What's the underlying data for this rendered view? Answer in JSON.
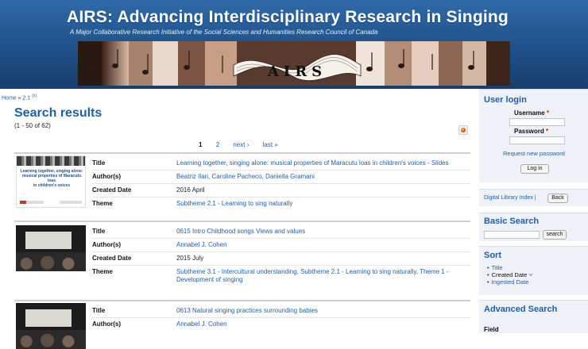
{
  "header": {
    "title": "AIRS: Advancing Interdisciplinary Research in Singing",
    "subtitle": "A Major Collaborative Research Initiative of the Social Sciences and Humanities Research Council of Canada",
    "logo_text": "AIRS"
  },
  "breadcrumb": {
    "home": "Home",
    "separator": "»",
    "current": "2.1",
    "current_sup": "(x)"
  },
  "results": {
    "title": "Search results",
    "count": "(1 - 50 of 62)",
    "pager": {
      "current": "1",
      "page2": "2",
      "next": "next ›",
      "last": "last »"
    },
    "field_labels": {
      "title": "Title",
      "authors": "Author(s)",
      "date": "Created Date",
      "theme": "Theme"
    },
    "items": [
      {
        "title": "Learning together, singing alone: musical properties of Maracutu loas in children's voices - Slides",
        "authors": "Beatriz Ilari, Caroline Pacheco, Daniella Gramani",
        "date": "2016 April",
        "theme": "Subtheme 2.1 - Learning to sing naturally",
        "thumb": {
          "line1": "Learning together, singing alone:",
          "line2": "musical properties of Maracutu loas",
          "line3": "in children's voices"
        }
      },
      {
        "title": "0615 Intro Childhood songs Views and values",
        "authors": "Annabel J. Cohen",
        "date": "2015 July",
        "theme": "Subtheme 3.1 - Intercultural understanding, Subtheme 2.1 - Learning to sing naturally, Theme 1 - Development of singing"
      },
      {
        "title": "0613 Natural singing practices surrounding babies",
        "authors": "Annabel J. Cohen"
      }
    ]
  },
  "sidebar": {
    "login": {
      "title": "User login",
      "username_label": "Username",
      "password_label": "Password",
      "required_mark": "*",
      "request_password": "Request new password",
      "login_button": "Log in"
    },
    "library": {
      "link": "Digital Library Index |",
      "back_button": "Back"
    },
    "basic_search": {
      "title": "Basic Search",
      "button": "search"
    },
    "sort": {
      "title": "Sort",
      "options": [
        "Title",
        "Created Date",
        "Ingested Date"
      ],
      "selected": "Created Date"
    },
    "advanced_search": {
      "title": "Advanced Search",
      "field_label": "Field"
    }
  },
  "colors": {
    "banner": "#1d4f86",
    "link": "#1f5fa8",
    "sidebar_bg": "#eef1f7",
    "required": "#cc2200"
  }
}
